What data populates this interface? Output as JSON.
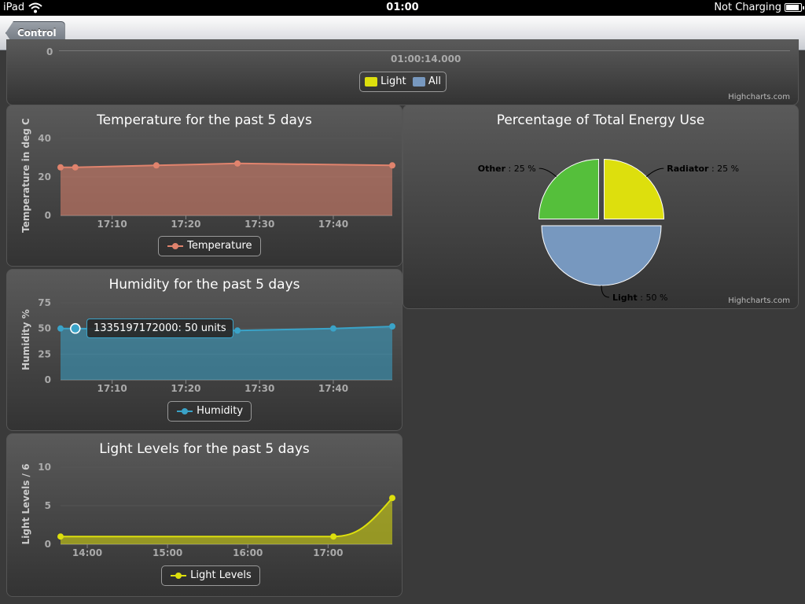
{
  "status": {
    "device": "iPad",
    "time": "01:00",
    "charging": "Not Charging"
  },
  "nav": {
    "back_label": "Control"
  },
  "top_chart": {
    "ytick": "0",
    "xtick": "01:00:14.000",
    "legend": [
      {
        "name": "Light",
        "color": "#dddf0d"
      },
      {
        "name": "All",
        "color": "#7798bf"
      }
    ],
    "credits": "Highcharts.com"
  },
  "temperature": {
    "title": "Temperature for the past 5 days",
    "ylabel": "Temperature in deg C",
    "legend": "Temperature",
    "color": "#e0836d",
    "chart_data": {
      "type": "area",
      "title": "Temperature for the past 5 days",
      "ylabel": "Temperature in deg C",
      "xticks": [
        "17:10",
        "17:20",
        "17:30",
        "17:40"
      ],
      "yticks": [
        0,
        20,
        40
      ],
      "ylim": [
        0,
        40
      ],
      "xlim": [
        "17:03",
        "17:48"
      ],
      "series": [
        {
          "name": "Temperature",
          "x": [
            "17:03",
            "17:05",
            "17:16",
            "17:27",
            "17:48"
          ],
          "y": [
            25,
            25,
            26,
            27,
            26
          ]
        }
      ]
    }
  },
  "humidity": {
    "title": "Humidity for the past 5 days",
    "ylabel": "Humidity %",
    "legend": "Humidity",
    "color": "#3aa3c8",
    "tooltip": "1335197172000: 50 units",
    "chart_data": {
      "type": "area",
      "title": "Humidity for the past 5 days",
      "ylabel": "Humidity %",
      "xticks": [
        "17:10",
        "17:20",
        "17:30",
        "17:40"
      ],
      "yticks": [
        0,
        25,
        50,
        75
      ],
      "ylim": [
        0,
        75
      ],
      "xlim": [
        "17:03",
        "17:48"
      ],
      "series": [
        {
          "name": "Humidity",
          "x": [
            "17:03",
            "17:05",
            "17:27",
            "17:40",
            "17:48"
          ],
          "y": [
            50,
            50,
            48,
            50,
            52
          ]
        }
      ]
    }
  },
  "light": {
    "title": "Light Levels for the past 5 days",
    "ylabel": "Light Levels / 6",
    "legend": "Light Levels",
    "color": "#dddf0d",
    "chart_data": {
      "type": "area",
      "title": "Light Levels for the past 5 days",
      "ylabel": "Light Levels / 6",
      "xticks": [
        "14:00",
        "15:00",
        "16:00",
        "17:00"
      ],
      "yticks": [
        0,
        5,
        10
      ],
      "ylim": [
        0,
        10
      ],
      "xlim": [
        "13:40",
        "17:48"
      ],
      "series": [
        {
          "name": "Light Levels",
          "x": [
            "13:40",
            "17:04",
            "17:48"
          ],
          "y": [
            1,
            1,
            6
          ]
        }
      ]
    }
  },
  "energy": {
    "title": "Percentage of Total Energy Use",
    "credits": "Highcharts.com",
    "chart_data": {
      "type": "pie",
      "title": "Percentage of Total Energy Use",
      "slices": [
        {
          "name": "Radiator",
          "value": 25,
          "label": ": 25 %",
          "color": "#dddf0d"
        },
        {
          "name": "Light",
          "value": 50,
          "label": ": 50 %",
          "color": "#7798bf"
        },
        {
          "name": "Other",
          "value": 25,
          "label": ": 25 %",
          "color": "#55bf3b"
        }
      ]
    }
  },
  "temp_credits": "",
  "battery_level": 0.85
}
